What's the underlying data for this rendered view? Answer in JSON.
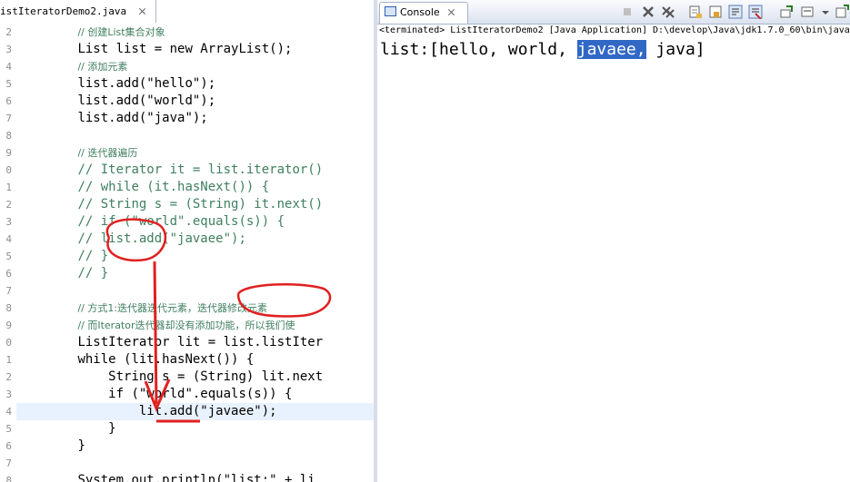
{
  "editor": {
    "tab_title": "istIteratorDemo2.java",
    "line_numbers": [
      "2",
      "3",
      "4",
      "5",
      "6",
      "7",
      "8",
      "9",
      "0",
      "1",
      "2",
      "3",
      "4",
      "5",
      "6",
      "7",
      "8",
      "9",
      "0",
      "1",
      "2",
      "3",
      "4",
      "5",
      "6",
      "7",
      "8"
    ],
    "comments": {
      "create_list": "// 创建List集合对象",
      "add_elements": "// 添加元素",
      "iterator_traverse": "// 迭代器遍历",
      "method1": "// 方式1:迭代器迭代元素，迭代器修改元素",
      "no_add": "// 而Iterator迭代器却没有添加功能，所以我们使"
    },
    "code_lines": {
      "l_list": "List list = new ArrayList();",
      "add_hello": "list.add(\"hello\");",
      "add_world": "list.add(\"world\");",
      "add_java": "list.add(\"java\");",
      "c_iter": "// Iterator it = list.iterator()",
      "c_while": "// while (it.hasNext()) {",
      "c_string": "// String s = (String) it.next()",
      "c_if": "// if (\"world\".equals(s)) {",
      "c_add": "// list.add(\"javaee\");",
      "c_close1": "// }",
      "c_close2": "// }",
      "lit_decl": "ListIterator lit = list.listIter",
      "while_lit": "while (lit.hasNext()) {",
      "str_s": "    String s = (String) lit.next",
      "if_world": "    if (\"world\".equals(s)) {",
      "lit_add": "        lit.add(\"javaee\");",
      "close_inner": "    }",
      "close_outer": "}",
      "println": "System.out.println(\"list:\" + li"
    }
  },
  "console": {
    "tab_title": "Console",
    "terminated": "<terminated> ListIteratorDemo2 [Java Application] D:\\develop\\Java\\jdk1.7.0_60\\bin\\javaw",
    "output_prefix": "list:[hello, world, ",
    "output_selected": "javaee,",
    "output_suffix": " java]"
  },
  "colors": {
    "comment": "#3f7f5f",
    "keyword": "#7f0055",
    "string": "#2a00ff",
    "selection": "#3168c6",
    "annotation_red": "#e02020"
  }
}
